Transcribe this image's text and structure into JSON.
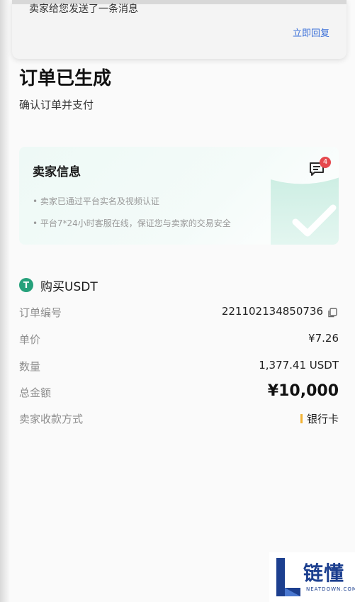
{
  "notification": {
    "message": "卖家给您发送了一条消息",
    "reply_label": "立即回复"
  },
  "page": {
    "title": "订单已生成",
    "subtitle": "确认订单并支付"
  },
  "seller": {
    "title": "卖家信息",
    "bullets": [
      "• 卖家已通过平台实名及视频认证",
      "• 平台7*24小时客服在线，保证您与卖家的交易安全"
    ],
    "unread_count": "4"
  },
  "purchase": {
    "heading": "购买USDT",
    "rows": [
      {
        "label": "订单编号",
        "value": "221102134850736"
      },
      {
        "label": "单价",
        "value": "¥7.26"
      },
      {
        "label": "数量",
        "value": "1,377.41 USDT"
      },
      {
        "label": "总金额",
        "value": "¥10,000"
      },
      {
        "label": "卖家收款方式",
        "value": "银行卡"
      }
    ]
  },
  "watermark": {
    "text": "链懂",
    "sub": "NEATDOWN.COM"
  },
  "colors": {
    "accent": "#26a17b",
    "link": "#3a6fd8",
    "badge": "#e5484d",
    "bank_marker": "#f2b233"
  },
  "icons": [
    "message-icon",
    "shield-check-icon",
    "usdt-icon",
    "copy-icon"
  ]
}
